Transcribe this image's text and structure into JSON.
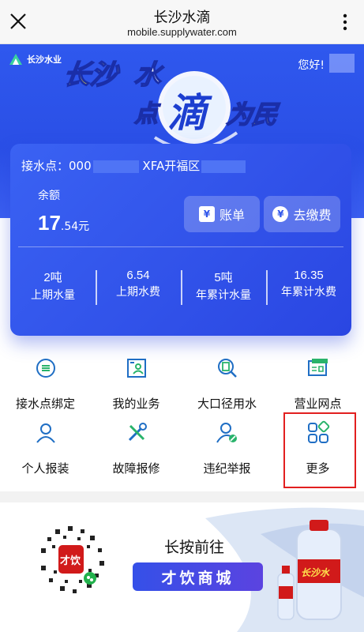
{
  "window": {
    "title": "长沙水滴",
    "url": "mobile.supplywater.com"
  },
  "banner": {
    "brand": "长沙水业",
    "greeting": "您好!",
    "slogan": [
      "长沙",
      "水",
      "点",
      "滴",
      "为民"
    ]
  },
  "card": {
    "point_prefix": "接水点：000",
    "point_suffix": "XFA开福区",
    "balance_label": "余额",
    "balance_int": "17",
    "balance_dec": ".54元",
    "bill_button": "账单",
    "pay_button": "去缴费",
    "bill_icon": "¥",
    "pay_icon": "¥",
    "stats": [
      {
        "value": "2吨",
        "label": "上期水量"
      },
      {
        "value": "6.54",
        "label": "上期水费"
      },
      {
        "value": "5吨",
        "label": "年累计水量"
      },
      {
        "value": "16.35",
        "label": "年累计水费"
      }
    ]
  },
  "services": [
    {
      "label": "接水点绑定",
      "icon": "water-meter-icon"
    },
    {
      "label": "我的业务",
      "icon": "id-card-icon"
    },
    {
      "label": "大口径用水",
      "icon": "search-document-icon"
    },
    {
      "label": "营业网点",
      "icon": "news-icon"
    },
    {
      "label": "个人报装",
      "icon": "person-icon"
    },
    {
      "label": "故障报修",
      "icon": "tools-icon"
    },
    {
      "label": "违纪举报",
      "icon": "report-person-icon"
    },
    {
      "label": "更多",
      "icon": "grid-more-icon"
    }
  ],
  "ad": {
    "hint": "长按前往",
    "mall": "才饮商城",
    "qr_logo": "才饮",
    "bottle_label": "长沙水"
  },
  "colors": {
    "primary": "#2f55ea",
    "icon": "#1f6ec4",
    "highlight": "#e21f1f"
  }
}
